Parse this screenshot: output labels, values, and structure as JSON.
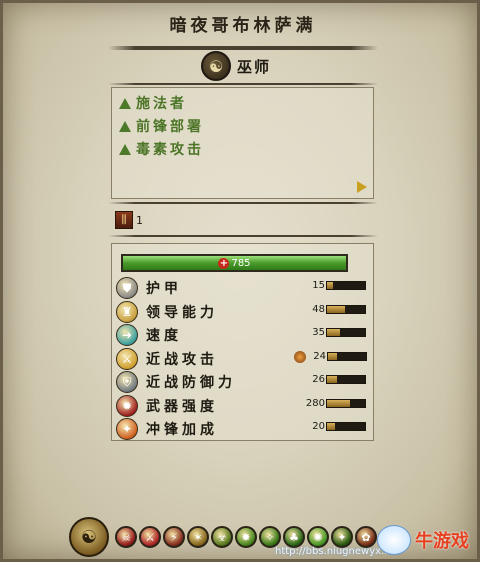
{
  "unit": {
    "title": "暗夜哥布林萨满",
    "class_icon": "shaman-emblem-icon",
    "class_name": "巫师"
  },
  "abilities": [
    {
      "label": "施法者",
      "icon": "green-triangle-icon"
    },
    {
      "label": "前锋部署",
      "icon": "green-triangle-icon"
    },
    {
      "label": "毒素攻击",
      "icon": "green-triangle-icon"
    }
  ],
  "unit_count": {
    "icon": "unit-stack-icon",
    "value": "1"
  },
  "health": {
    "icon": "red-cross-icon",
    "value": "785",
    "fill": 1.0
  },
  "stats": [
    {
      "label": "护甲",
      "value": "15",
      "icon": "armor-icon",
      "fill": 0.15,
      "color": "#8a8a8a"
    },
    {
      "label": "领导能力",
      "value": "48",
      "icon": "leadership-icon",
      "fill": 0.48,
      "color": "#c8a040"
    },
    {
      "label": "速度",
      "value": "35",
      "icon": "speed-arrow-icon",
      "fill": 0.35,
      "color": "#3aa0a0"
    },
    {
      "label": "近战攻击",
      "value": "24",
      "icon": "melee-attack-icon",
      "fill": 0.24,
      "color": "#d0a030",
      "badge": "fire-damage-icon"
    },
    {
      "label": "近战防御力",
      "value": "26",
      "icon": "melee-defence-icon",
      "fill": 0.26,
      "color": "#707a80"
    },
    {
      "label": "武器强度",
      "value": "280",
      "icon": "weapon-strength-icon",
      "fill": 0.6,
      "color": "#a02020"
    },
    {
      "label": "冲锋加成",
      "value": "20",
      "icon": "charge-bonus-icon",
      "fill": 0.2,
      "color": "#d06020"
    }
  ],
  "ability_bar": {
    "emblem": "faction-emblem-icon",
    "icons": [
      {
        "name": "ability-icon-1",
        "color": "#9a2020"
      },
      {
        "name": "ability-icon-2",
        "color": "#b02828"
      },
      {
        "name": "ability-icon-3",
        "color": "#8a3020"
      },
      {
        "name": "ability-icon-4",
        "color": "#8a6a20"
      },
      {
        "name": "ability-icon-5",
        "color": "#5a7a20"
      },
      {
        "name": "ability-icon-6",
        "color": "#4a8a20"
      },
      {
        "name": "ability-icon-7",
        "color": "#3a7a18"
      },
      {
        "name": "ability-icon-8",
        "color": "#2a6a18"
      },
      {
        "name": "ability-icon-9",
        "color": "#4a9a28"
      },
      {
        "name": "ability-icon-10",
        "color": "#2a5a10"
      },
      {
        "name": "ability-icon-11",
        "color": "#7a3018"
      }
    ]
  },
  "watermark": {
    "brand": "牛游戏",
    "url": "http://bbs.niugnewyx.net"
  }
}
